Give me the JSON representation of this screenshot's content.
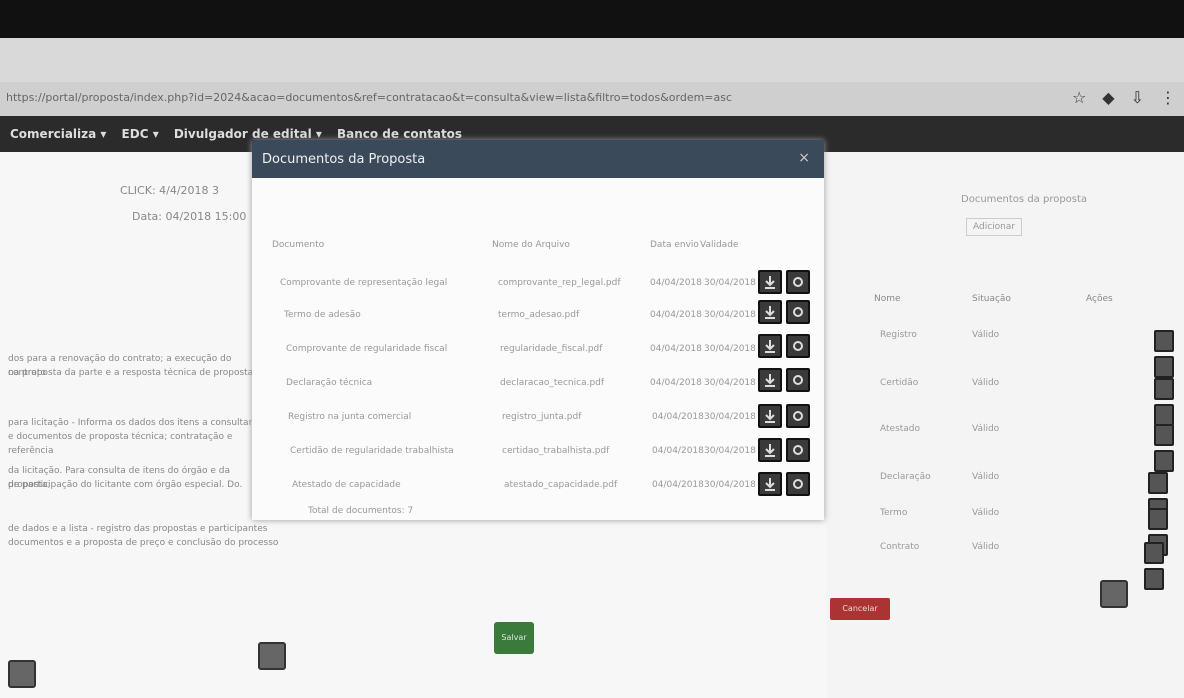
{
  "browser": {
    "address": "https://portal/proposta/index.php?id=2024&acao=documentos&ref=contratacao&t=consulta&view=lista&filtro=todos&ordem=asc",
    "icons": [
      "star-icon",
      "extension-icon",
      "download-icon",
      "menu-icon"
    ]
  },
  "nav": {
    "items": [
      "Comercializa ▾",
      "EDC ▾",
      "Divulgador de edital ▾",
      "Banco de contatos"
    ]
  },
  "page": {
    "meta_line1": "CLICK: 4/4/2018 3",
    "meta_line2": "Data: 04/2018 15:00",
    "left_text": [
      "dos para a renovação do contrato; a execução do contrato",
      "na proposta da parte e a resposta técnica de proposta.",
      "para licitação - Informa os dados dos itens a consultar;",
      "e documentos de proposta técnica; contratação e referência",
      "da licitação. Para consulta de itens do órgão e da proposta;",
      "de participação do licitante com órgão especial. Do.",
      "de dados e a lista - registro das propostas e participantes",
      "documentos e a proposta de preço e conclusão do processo"
    ]
  },
  "modal": {
    "title": "Documentos da Proposta",
    "close": "×",
    "columns": [
      "Documento",
      "Nome do Arquivo",
      "Data envio",
      "Validade"
    ],
    "rows": [
      {
        "doc": "Comprovante de representação legal",
        "file": "comprovante_rep_legal.pdf",
        "date": "04/04/2018",
        "valid": "30/04/2018"
      },
      {
        "doc": "Termo de adesão",
        "file": "termo_adesao.pdf",
        "date": "04/04/2018",
        "valid": "30/04/2018"
      },
      {
        "doc": "Comprovante de regularidade fiscal",
        "file": "regularidade_fiscal.pdf",
        "date": "04/04/2018",
        "valid": "30/04/2018"
      },
      {
        "doc": "Declaração técnica",
        "file": "declaracao_tecnica.pdf",
        "date": "04/04/2018",
        "valid": "30/04/2018"
      },
      {
        "doc": "Registro na junta comercial",
        "file": "registro_junta.pdf",
        "date": "04/04/2018",
        "valid": "30/04/2018"
      },
      {
        "doc": "Certidão de regularidade trabalhista",
        "file": "certidao_trabalhista.pdf",
        "date": "04/04/2018",
        "valid": "30/04/2018"
      },
      {
        "doc": "Atestado de capacidade",
        "file": "atestado_capacidade.pdf",
        "date": "04/04/2018",
        "valid": "30/04/2018"
      }
    ],
    "footer_note": "Total de documentos: 7"
  },
  "right_panel": {
    "title": "Documentos da proposta",
    "button": "Adicionar",
    "columns": [
      "Nome",
      "Situação",
      "Ações"
    ],
    "rows": [
      {
        "name": "Registro",
        "status": "Válido"
      },
      {
        "name": "Certidão",
        "status": "Válido"
      },
      {
        "name": "Atestado",
        "status": "Válido"
      },
      {
        "name": "Declaração",
        "status": "Válido"
      },
      {
        "name": "Termo",
        "status": "Válido"
      },
      {
        "name": "Contrato",
        "status": "Válido"
      }
    ]
  },
  "buttons": {
    "cancel": "Cancelar",
    "save": "Salvar"
  },
  "colors": {
    "modal_header": "#3b4a5a",
    "navbar": "#2b2b2b",
    "danger": "#aa3333",
    "success": "#3a7a3a"
  }
}
